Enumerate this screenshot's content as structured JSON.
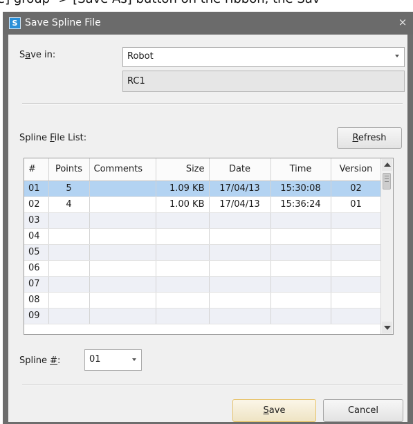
{
  "background_text": "e] group -> [Save As] button on the ribbon, the Sav",
  "window": {
    "title": "Save Spline File",
    "icon_letter": "S",
    "close_glyph": "×"
  },
  "save_in": {
    "label_pre": "S",
    "label_underlined": "a",
    "label_post": "ve in:",
    "value": "Robot",
    "sub_value": "RC1"
  },
  "spline_list": {
    "label_pre": "Spline ",
    "label_underlined": "F",
    "label_post": "ile List:",
    "refresh_label_underlined": "R",
    "refresh_label_post": "efresh",
    "columns": [
      "#",
      "Points",
      "Comments",
      "Size",
      "Date",
      "Time",
      "Version"
    ],
    "rows": [
      {
        "num": "01",
        "points": "5",
        "comments": "",
        "size": "1.09 KB",
        "date": "17/04/13",
        "time": "15:30:08",
        "version": "02"
      },
      {
        "num": "02",
        "points": "4",
        "comments": "",
        "size": "1.00 KB",
        "date": "17/04/13",
        "time": "15:36:24",
        "version": "01"
      },
      {
        "num": "03",
        "points": "",
        "comments": "",
        "size": "",
        "date": "",
        "time": "",
        "version": ""
      },
      {
        "num": "04",
        "points": "",
        "comments": "",
        "size": "",
        "date": "",
        "time": "",
        "version": ""
      },
      {
        "num": "05",
        "points": "",
        "comments": "",
        "size": "",
        "date": "",
        "time": "",
        "version": ""
      },
      {
        "num": "06",
        "points": "",
        "comments": "",
        "size": "",
        "date": "",
        "time": "",
        "version": ""
      },
      {
        "num": "07",
        "points": "",
        "comments": "",
        "size": "",
        "date": "",
        "time": "",
        "version": ""
      },
      {
        "num": "08",
        "points": "",
        "comments": "",
        "size": "",
        "date": "",
        "time": "",
        "version": ""
      },
      {
        "num": "09",
        "points": "",
        "comments": "",
        "size": "",
        "date": "",
        "time": "",
        "version": ""
      }
    ],
    "selected_row": 0
  },
  "spline_num": {
    "label_pre": "Spline ",
    "label_underlined": "#",
    "label_post": ":",
    "value": "01"
  },
  "buttons": {
    "save_underlined": "S",
    "save_post": "ave",
    "cancel": "Cancel"
  },
  "colors": {
    "titlebar": "#6b6b6b",
    "selection": "#b3d3f2",
    "alt_row": "#eef0f6",
    "accent_icon": "#2a8fd8"
  }
}
